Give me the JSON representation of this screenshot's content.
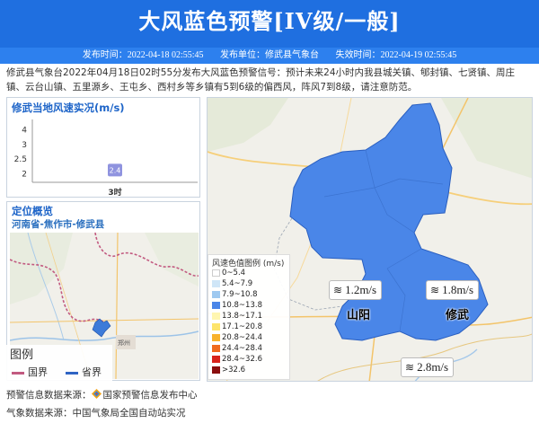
{
  "header": {
    "title": "大风蓝色预警[IV级/一般]",
    "publish_time": "发布时间：2022-04-18 02:55:45",
    "publisher": "发布单位：修武县气象台",
    "expire_time": "失效时间：2022-04-19 02:55:45"
  },
  "description": "修武县气象台2022年04月18日02时55分发布大风蓝色预警信号：预计未来24小时内我县城关镇、郇封镇、七贤镇、周庄镇、云台山镇、五里源乡、王屯乡、西村乡等乡镇有5到6级的偏西风，阵风7到8级，请注意防范。",
  "wind_panel": {
    "title": "修武当地风速实况(m/s)"
  },
  "chart_data": {
    "type": "bar",
    "categories": [
      "3时"
    ],
    "values": [
      2.4
    ],
    "data_labels": [
      "2.4"
    ],
    "yticks": [
      "4",
      "3",
      "2.5",
      "2"
    ],
    "ylim": [
      2,
      4
    ],
    "grid": false,
    "bar_color": "#8f93df"
  },
  "location": {
    "title": "定位概览",
    "path": "河南省-焦作市-修武县",
    "legend_title": "图例",
    "legend_items": [
      {
        "label": "国界",
        "color": "#c25a80"
      },
      {
        "label": "省界",
        "color": "#2f64c4"
      }
    ]
  },
  "wind_legend": {
    "title": "风速色值图例 (m/s)",
    "items": [
      {
        "label": "0~5.4",
        "color": "#ffffff"
      },
      {
        "label": "5.4~7.9",
        "color": "#cfe6f7"
      },
      {
        "label": "7.9~10.8",
        "color": "#9ec9f0"
      },
      {
        "label": "10.8~13.8",
        "color": "#4a86e8"
      },
      {
        "label": "13.8~17.1",
        "color": "#fff6b0"
      },
      {
        "label": "17.1~20.8",
        "color": "#fde46b"
      },
      {
        "label": "20.8~24.4",
        "color": "#f8b22c"
      },
      {
        "label": "24.4~28.4",
        "color": "#f06a1d"
      },
      {
        "label": "28.4~32.6",
        "color": "#d8231b"
      },
      {
        "label": ">32.6",
        "color": "#8a0e0e"
      }
    ]
  },
  "stations": [
    {
      "name": "山阳",
      "speed": "1.2m/s"
    },
    {
      "name": "修武",
      "speed": "1.8m/s"
    },
    {
      "name": "",
      "speed": "2.8m/s"
    }
  ],
  "footer": {
    "warning_source_label": "预警信息数据来源：",
    "warning_source": "国家预警信息发布中心",
    "weather_source": "气象数据来源：中国气象局全国自动站实况"
  },
  "colors": {
    "header_bg": "#1f6fe0",
    "accent": "#1d64c8",
    "warning_area": "#4a86e8"
  }
}
